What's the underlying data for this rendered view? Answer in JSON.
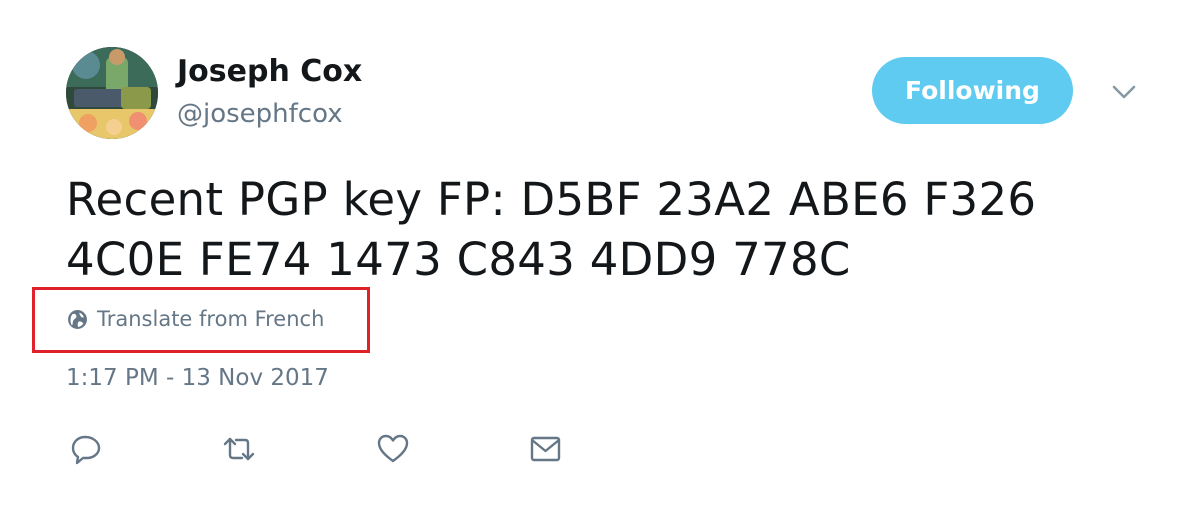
{
  "author": {
    "display_name": "Joseph Cox",
    "handle": "@josephfcox"
  },
  "follow_button": {
    "label": "Following",
    "color": "#5fcbf0"
  },
  "tweet": {
    "text_lines": [
      "Recent PGP key FP: D5BF 23A2 ABE6 F326",
      "4C0E FE74 1473 C843 4DD9 778C"
    ],
    "translate_label": "Translate from French",
    "timestamp": "1:17 PM - 13 Nov 2017"
  },
  "highlight": {
    "color": "#e0202a"
  },
  "icons": {
    "translate": "globe-icon",
    "menu": "chevron-down-icon",
    "actions": [
      "reply-icon",
      "retweet-icon",
      "like-icon",
      "direct-message-icon"
    ]
  },
  "colors": {
    "text": "#14171a",
    "secondary_text": "#657786"
  }
}
